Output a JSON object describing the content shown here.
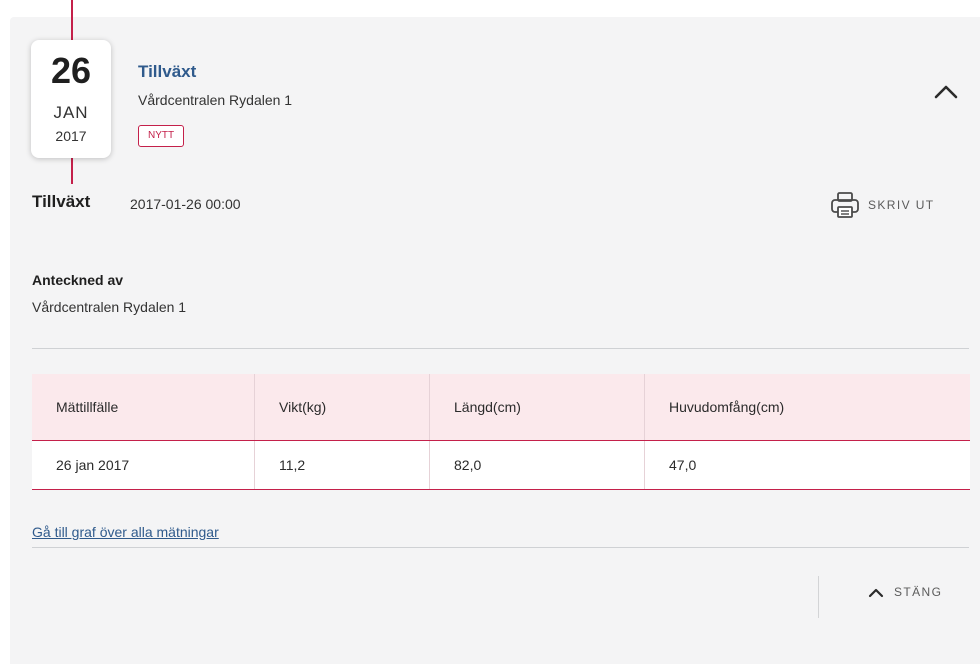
{
  "entry": {
    "date": {
      "day": "26",
      "month": "JAN",
      "year": "2017"
    },
    "title": "Tillväxt",
    "clinic": "Vårdcentralen Rydalen 1",
    "badge": "NYTT",
    "collapse_icon": "chevron-up-icon"
  },
  "detail": {
    "title": "Tillväxt",
    "datetime": "2017-01-26 00:00",
    "print_label": "SKRIV UT",
    "print_icon": "printer-icon",
    "annotated_by_label": "Anteckned av",
    "annotated_by_value": "Vårdcentralen Rydalen 1"
  },
  "table": {
    "headers": [
      "Mättillfälle",
      "Vikt(kg)",
      "Längd(cm)",
      "Huvudomfång(cm)"
    ],
    "rows": [
      [
        "26 jan 2017",
        "11,2",
        "82,0",
        "47,0"
      ]
    ]
  },
  "links": {
    "graph": "Gå till graf över alla mätningar"
  },
  "footer": {
    "close_label": "STÄNG",
    "close_icon": "chevron-up-icon"
  },
  "colors": {
    "accent": "#c4204a",
    "title_blue": "#2f5a8c",
    "card_bg": "#f4f4f5",
    "table_header_bg": "#fbe9ec"
  }
}
